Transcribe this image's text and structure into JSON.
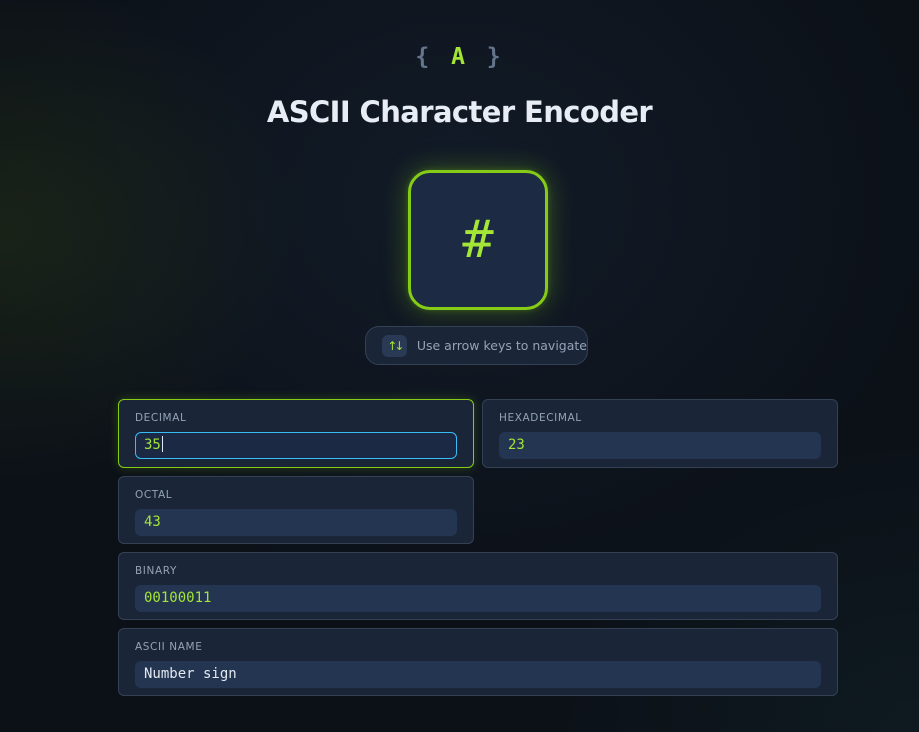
{
  "logo": {
    "left_brace": "{",
    "letter": "A",
    "right_brace": "}"
  },
  "title": "ASCII Character Encoder",
  "character_display": "#",
  "hint": {
    "icon": "arrow-keys-icon",
    "text": "Use arrow keys to navigate"
  },
  "fields": {
    "decimal": {
      "label": "DECIMAL",
      "value": "35"
    },
    "hexadecimal": {
      "label": "HEXADECIMAL",
      "value": "23"
    },
    "octal": {
      "label": "OCTAL",
      "value": "43"
    },
    "binary": {
      "label": "BINARY",
      "value": "00100011"
    },
    "ascii_name": {
      "label": "ASCII NAME",
      "value": "Number sign"
    }
  },
  "colors": {
    "accent": "#a3e635",
    "focus": "#38bdf8",
    "card_bg": "#1a2537",
    "field_bg": "#243552"
  }
}
